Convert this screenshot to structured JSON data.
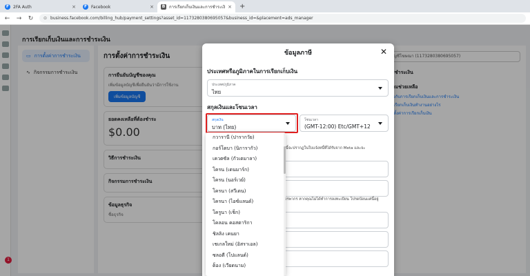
{
  "browser": {
    "tabs": [
      {
        "title": "2FA Auth",
        "icon": "F"
      },
      {
        "title": "Facebook",
        "icon": "F"
      },
      {
        "title": "การเรียกเก็บเงินและการชำระเงิน",
        "icon": "B"
      }
    ],
    "new_tab": "+",
    "close": "×",
    "url": "business.facebook.com/billing_hub/payment_settings?asset_id=1173280380695057&business_id=&placement=ads_manager"
  },
  "background": {
    "page_title": "การเรียกเก็บเงินและการชำระเงิน",
    "nav": [
      "การตั้งค่าการชำระเงิน",
      "กิจกรรมการชำระเงิน"
    ],
    "main_title": "การตั้งค่าการชำระเงิน",
    "verify_title": "การยืนยันบัญชีของคุณ",
    "verify_text": "เพิ่มข้อมูลบัญชีเพื่อยืนยันว่ามีการใช้งาน",
    "verify_button": "เพิ่มข้อมูลบัญชี",
    "balance_label": "ยอดคงเหลือที่ต้องชำระ",
    "balance": "$0.00",
    "payment_method": "วิธีการชำระเงิน",
    "payment_activity": "กิจกรรมการชำระเงิน",
    "business_info": "ข้อมูลธุรกิจ",
    "biz_name": "ชื่อธุรกิจ",
    "right_select": "บัญชีโฆษณา (1173280380695057)",
    "right_h1": "การชำระเงิน",
    "right_h2": "ความช่วยเหลือ",
    "right_link1": "เกี่ยวกับการเรียกเก็บเงินและการชำระเงิน",
    "right_link2": "การเรียกเก็บเงินทำงานอย่างไร",
    "right_link3": "การตั้งค่าการเรียกเก็บเงิน",
    "notif_count": "1"
  },
  "modal": {
    "title": "ข้อมูลภาษี",
    "close": "✕",
    "section_country": "ประเทศหรือภูมิภาคในการเรียกเก็บเงิน",
    "country_label": "ประเทศ/ภูมิภาค",
    "country_value": "ไทย",
    "section_currency": "สกุลเงินและโซนเวลา",
    "currency_label": "สกุลเงิน",
    "currency_value": "บาท (ไทย)",
    "timezone_label": "โซนเวลา",
    "timezone_value": "(GMT-12:00) Etc/GMT+12",
    "note1": "ข้อมูลนี้จะปรากฏในใบแจ้งหนี้ที่ได้รับจาก Meta และจะ",
    "note2": "เพิ่มสรรพากร หากคุณไม่ได้ทำการลงทะเบียน โปรดป้อนแค่นี้อยู่"
  },
  "dropdown": {
    "items": [
      "กวารานี (ปารากวัย)",
      "กอร์โดบา (นิการากัว)",
      "เควตซัล (กัวเตมาลา)",
      "โครน (เดนมาร์ก)",
      "โครน (นอร์เวย์)",
      "โครนา (สวีเดน)",
      "โครนา (ไอซ์แลนด์)",
      "โครูนา (เช็ก)",
      "โคลอน คอสตาริกา",
      "ชิลลิง เคนยา",
      "เชเกลใหม่ (อิสราเอล)",
      "ซลอตี (โปแลนด์)",
      "ด็อง (เวียดนาม)"
    ]
  },
  "colors": {
    "accent": "#1877f2",
    "highlight": "#e02020"
  }
}
